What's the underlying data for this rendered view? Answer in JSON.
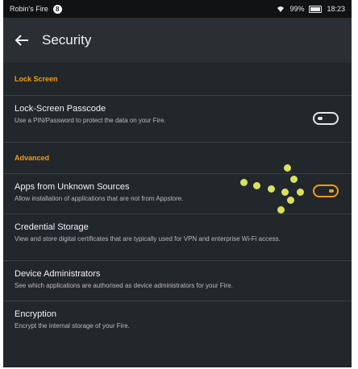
{
  "status_bar": {
    "device_name": "Robin's Fire",
    "badge": "8",
    "battery_text": "99%",
    "time": "18:23"
  },
  "header": {
    "title": "Security"
  },
  "sections": [
    {
      "label": "Lock Screen",
      "items": [
        {
          "title": "Lock-Screen Passcode",
          "subtitle": "Use a PIN/Password to protect the data on your Fire.",
          "toggle": "off"
        }
      ]
    },
    {
      "label": "Advanced",
      "items": [
        {
          "title": "Apps from Unknown Sources",
          "subtitle": "Allow installation of applications that are not from Appstore.",
          "toggle": "on"
        },
        {
          "title": "Credential Storage",
          "subtitle": "View and store digital certificates that are typically used for VPN and enterprise Wi-Fi access."
        },
        {
          "title": "Device Administrators",
          "subtitle": "See which applications are authorised as device administrators for your Fire."
        },
        {
          "title": "Encryption",
          "subtitle": "Encrypt the internal storage of your Fire."
        }
      ]
    }
  ],
  "colors": {
    "accent": "#f39c12",
    "background": "#22272c",
    "annotation_dots": "#d9e25f"
  },
  "icons": {
    "back": "back-arrow-icon",
    "wifi": "wifi-icon",
    "battery": "battery-icon"
  }
}
